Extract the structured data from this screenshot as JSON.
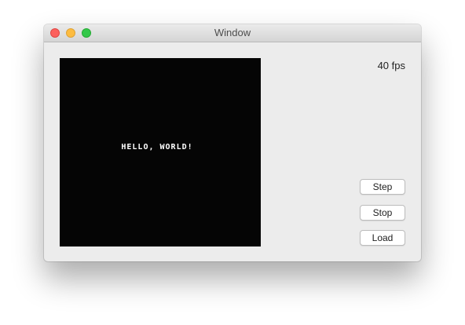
{
  "window": {
    "title": "Window"
  },
  "traffic_lights": {
    "close_color": "#fc605c",
    "minimize_color": "#fdbc40",
    "maximize_color": "#34c84a"
  },
  "screen": {
    "text": "HELLO, WORLD!",
    "background": "#050505"
  },
  "status": {
    "fps": "40 fps"
  },
  "controls": {
    "step_label": "Step",
    "stop_label": "Stop",
    "load_label": "Load"
  }
}
